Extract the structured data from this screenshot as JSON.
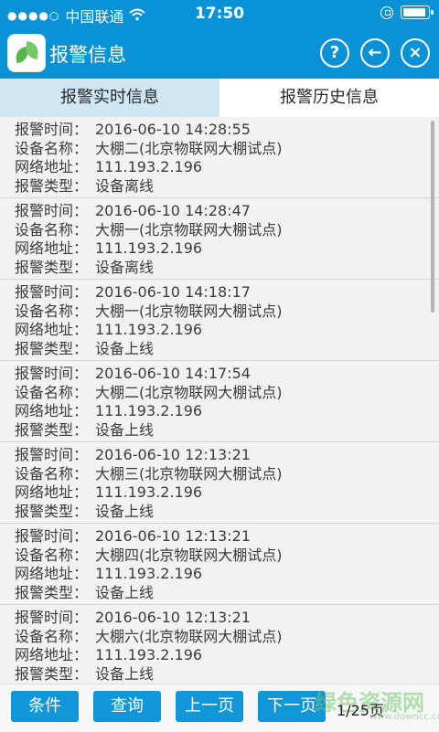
{
  "status_bar": {
    "carrier": "中国联通",
    "time": "17:50"
  },
  "header": {
    "title": "报警信息",
    "help_label": "?",
    "back_label": "←",
    "close_label": "×"
  },
  "tabs": [
    {
      "label": "报警实时信息",
      "active": true
    },
    {
      "label": "报警历史信息",
      "active": false
    }
  ],
  "labels": {
    "time": "报警时间：",
    "device": "设备名称：",
    "address": "网络地址：",
    "type": "报警类型："
  },
  "alarms": [
    {
      "time": "2016-06-10 14:28:55",
      "device": "大棚二(北京物联网大棚试点)",
      "address": "111.193.2.196",
      "type": "设备离线"
    },
    {
      "time": "2016-06-10 14:28:47",
      "device": "大棚一(北京物联网大棚试点)",
      "address": "111.193.2.196",
      "type": "设备离线"
    },
    {
      "time": "2016-06-10 14:18:17",
      "device": "大棚一(北京物联网大棚试点)",
      "address": "111.193.2.196",
      "type": "设备上线"
    },
    {
      "time": "2016-06-10 14:17:54",
      "device": "大棚二(北京物联网大棚试点)",
      "address": "111.193.2.196",
      "type": "设备上线"
    },
    {
      "time": "2016-06-10 12:13:21",
      "device": "大棚三(北京物联网大棚试点)",
      "address": "111.193.2.196",
      "type": "设备上线"
    },
    {
      "time": "2016-06-10 12:13:21",
      "device": "大棚四(北京物联网大棚试点)",
      "address": "111.193.2.196",
      "type": "设备上线"
    },
    {
      "time": "2016-06-10 12:13:21",
      "device": "大棚六(北京物联网大棚试点)",
      "address": "111.193.2.196",
      "type": "设备上线"
    }
  ],
  "bottom_bar": {
    "condition_label": "条件",
    "query_label": "查询",
    "prev_label": "上一页",
    "next_label": "下一页",
    "page_info": "1/25页",
    "watermark": "绿色资源网",
    "watermark_url": "www.downcc.com"
  },
  "colors": {
    "primary": "#0a92d6",
    "active_tab": "#cfe6f4"
  }
}
